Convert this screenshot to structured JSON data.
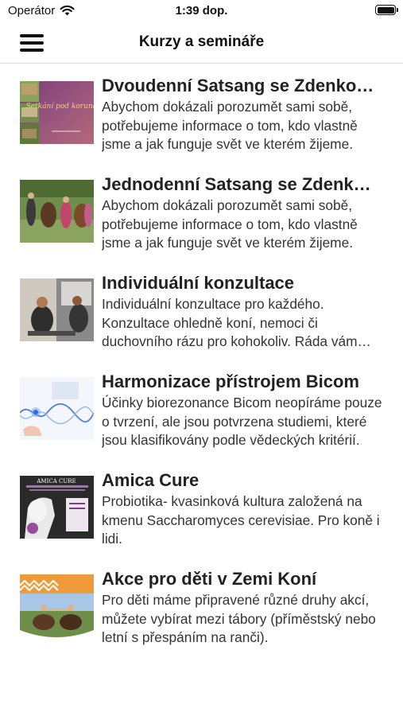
{
  "status_bar": {
    "carrier": "Operátor",
    "time": "1:39 dop."
  },
  "nav": {
    "title": "Kurzy a semináře"
  },
  "courses": [
    {
      "title": "Dvoudenní Satsang se Zdenkou Tomanovou",
      "description": "Abychom dokázali porozumět sami sobě, potřebujeme informace o tom, kdo vlastně jsme a jak funguje svět ve kterém žijeme.",
      "thumb_text": "Setkání pod korunami"
    },
    {
      "title": "Jednodenní Satsang se Zdenkou Tomanovou",
      "description": "Abychom dokázali porozumět sami sobě, potřebujeme informace o tom, kdo vlastně jsme a jak funguje svět ve kterém žijeme."
    },
    {
      "title": "Individuální konzultace",
      "description": "Individuální konzultace pro každého. Konzultace ohledně koní, nemoci či duchovního rázu pro kohokoliv. Ráda vám pomohu."
    },
    {
      "title": "Harmonizace přístrojem Bicom",
      "description": "Účinky biorezonance Bicom neopíráme pouze o tvrzení, ale jsou potvrzena studiemi, které jsou klasifikovány podle vědeckých kritérií."
    },
    {
      "title": "Amica Cure",
      "description": "Probiotika- kvasinková kultura založená na kmenu Saccharomyces cerevisiae. Pro koně i lidi.",
      "thumb_text": "AMICA CURE"
    },
    {
      "title": "Akce pro děti v Zemi Koní",
      "description": "Pro děti máme připravené různé druhy akcí, můžete vybírat mezi tábory (příměstský nebo letní s přespáním na ranči)."
    }
  ]
}
